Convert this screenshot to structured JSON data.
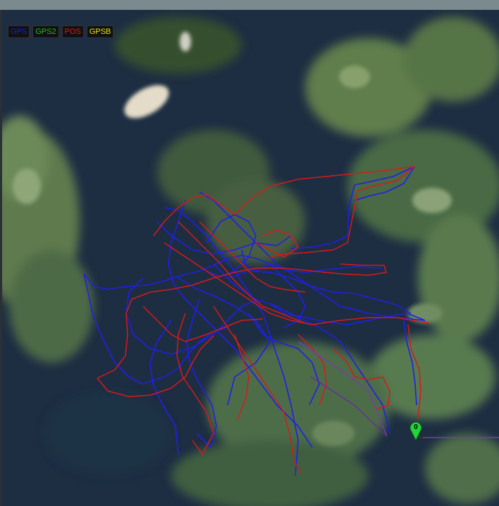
{
  "legend": {
    "items": [
      {
        "label": "GPS",
        "color": "#1e1ee8"
      },
      {
        "label": "GPS2",
        "color": "#18c018"
      },
      {
        "label": "POS",
        "color": "#e01818"
      },
      {
        "label": "GPSB",
        "color": "#e6e600"
      }
    ]
  },
  "marker": {
    "label": "0",
    "color": "#22d43a"
  },
  "tracks": {
    "gps_color": "#2020e8",
    "pos_color": "#d81a1a",
    "link_color": "#7a3ab0"
  }
}
